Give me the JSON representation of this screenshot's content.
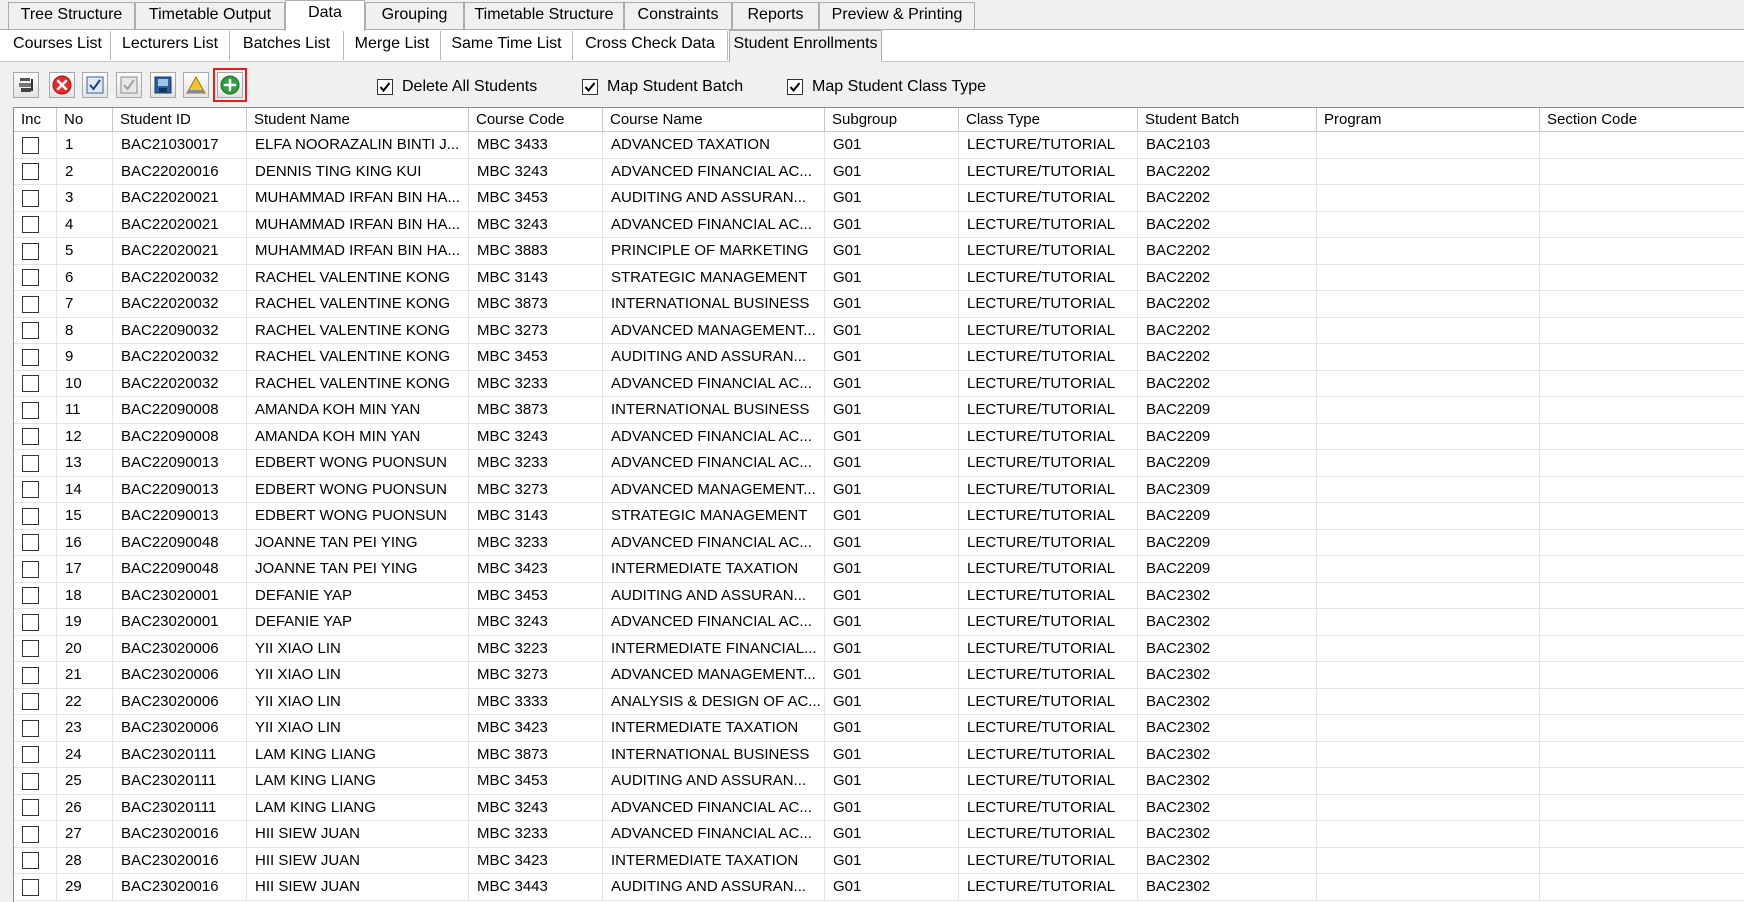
{
  "main_tabs": [
    {
      "label": "Tree Structure"
    },
    {
      "label": "Timetable Output"
    },
    {
      "label": "Data",
      "active": true
    },
    {
      "label": "Grouping"
    },
    {
      "label": "Timetable Structure"
    },
    {
      "label": "Constraints"
    },
    {
      "label": "Reports"
    },
    {
      "label": "Preview & Printing"
    }
  ],
  "sub_tabs": [
    {
      "label": "Courses List"
    },
    {
      "label": "Lecturers List"
    },
    {
      "label": "Batches List"
    },
    {
      "label": "Merge List"
    },
    {
      "label": "Same Time List"
    },
    {
      "label": "Cross Check Data"
    },
    {
      "label": "Student Enrollments",
      "active": true
    }
  ],
  "toolbar": {
    "buttons": [
      "import-icon",
      "delete-icon",
      "check-all-icon",
      "uncheck-all-icon",
      "save-icon",
      "warning-icon",
      "add-icon"
    ],
    "options": [
      {
        "label": "Delete All Students",
        "checked": true
      },
      {
        "label": "Map Student Batch",
        "checked": true
      },
      {
        "label": "Map Student Class Type",
        "checked": true
      }
    ]
  },
  "grid": {
    "columns": [
      "Inc",
      "No",
      "Student ID",
      "Student Name",
      "Course Code",
      "Course Name",
      "Subgroup",
      "Class Type",
      "Student Batch",
      "Program",
      "Section Code"
    ],
    "rows": [
      [
        "1",
        "BAC21030017",
        "ELFA NOORAZALIN BINTI J...",
        "MBC 3433",
        "ADVANCED TAXATION",
        "G01",
        "LECTURE/TUTORIAL",
        "BAC2103",
        "",
        ""
      ],
      [
        "2",
        "BAC22020016",
        "DENNIS TING KING KUI",
        "MBC 3243",
        "ADVANCED FINANCIAL AC...",
        "G01",
        "LECTURE/TUTORIAL",
        "BAC2202",
        "",
        ""
      ],
      [
        "3",
        "BAC22020021",
        "MUHAMMAD IRFAN BIN HA...",
        "MBC 3453",
        "AUDITING AND ASSURAN...",
        "G01",
        "LECTURE/TUTORIAL",
        "BAC2202",
        "",
        ""
      ],
      [
        "4",
        "BAC22020021",
        "MUHAMMAD IRFAN BIN HA...",
        "MBC 3243",
        "ADVANCED FINANCIAL AC...",
        "G01",
        "LECTURE/TUTORIAL",
        "BAC2202",
        "",
        ""
      ],
      [
        "5",
        "BAC22020021",
        "MUHAMMAD IRFAN BIN HA...",
        "MBC 3883",
        "PRINCIPLE OF MARKETING",
        "G01",
        "LECTURE/TUTORIAL",
        "BAC2202",
        "",
        ""
      ],
      [
        "6",
        "BAC22020032",
        "RACHEL VALENTINE KONG",
        "MBC 3143",
        "STRATEGIC MANAGEMENT",
        "G01",
        "LECTURE/TUTORIAL",
        "BAC2202",
        "",
        ""
      ],
      [
        "7",
        "BAC22020032",
        "RACHEL VALENTINE KONG",
        "MBC 3873",
        "INTERNATIONAL BUSINESS",
        "G01",
        "LECTURE/TUTORIAL",
        "BAC2202",
        "",
        ""
      ],
      [
        "8",
        "BAC22090032",
        "RACHEL VALENTINE KONG",
        "MBC 3273",
        "ADVANCED MANAGEMENT...",
        "G01",
        "LECTURE/TUTORIAL",
        "BAC2202",
        "",
        ""
      ],
      [
        "9",
        "BAC22020032",
        "RACHEL VALENTINE KONG",
        "MBC 3453",
        "AUDITING AND ASSURAN...",
        "G01",
        "LECTURE/TUTORIAL",
        "BAC2202",
        "",
        ""
      ],
      [
        "10",
        "BAC22020032",
        "RACHEL VALENTINE KONG",
        "MBC 3233",
        "ADVANCED FINANCIAL AC...",
        "G01",
        "LECTURE/TUTORIAL",
        "BAC2202",
        "",
        ""
      ],
      [
        "11",
        "BAC22090008",
        "AMANDA KOH MIN YAN",
        "MBC 3873",
        "INTERNATIONAL BUSINESS",
        "G01",
        "LECTURE/TUTORIAL",
        "BAC2209",
        "",
        ""
      ],
      [
        "12",
        "BAC22090008",
        "AMANDA KOH MIN YAN",
        "MBC 3243",
        "ADVANCED FINANCIAL AC...",
        "G01",
        "LECTURE/TUTORIAL",
        "BAC2209",
        "",
        ""
      ],
      [
        "13",
        "BAC22090013",
        "EDBERT WONG PUONSUN",
        "MBC 3233",
        "ADVANCED FINANCIAL AC...",
        "G01",
        "LECTURE/TUTORIAL",
        "BAC2209",
        "",
        ""
      ],
      [
        "14",
        "BAC22090013",
        "EDBERT WONG PUONSUN",
        "MBC 3273",
        "ADVANCED MANAGEMENT...",
        "G01",
        "LECTURE/TUTORIAL",
        "BAC2309",
        "",
        ""
      ],
      [
        "15",
        "BAC22090013",
        "EDBERT WONG PUONSUN",
        "MBC 3143",
        "STRATEGIC MANAGEMENT",
        "G01",
        "LECTURE/TUTORIAL",
        "BAC2209",
        "",
        ""
      ],
      [
        "16",
        "BAC22090048",
        "JOANNE TAN PEI YING",
        "MBC 3233",
        "ADVANCED FINANCIAL AC...",
        "G01",
        "LECTURE/TUTORIAL",
        "BAC2209",
        "",
        ""
      ],
      [
        "17",
        "BAC22090048",
        "JOANNE TAN PEI YING",
        "MBC 3423",
        "INTERMEDIATE TAXATION",
        "G01",
        "LECTURE/TUTORIAL",
        "BAC2209",
        "",
        ""
      ],
      [
        "18",
        "BAC23020001",
        "DEFANIE YAP",
        "MBC 3453",
        "AUDITING AND ASSURAN...",
        "G01",
        "LECTURE/TUTORIAL",
        "BAC2302",
        "",
        ""
      ],
      [
        "19",
        "BAC23020001",
        "DEFANIE YAP",
        "MBC 3243",
        "ADVANCED FINANCIAL AC...",
        "G01",
        "LECTURE/TUTORIAL",
        "BAC2302",
        "",
        ""
      ],
      [
        "20",
        "BAC23020006",
        "YII XIAO LIN",
        "MBC 3223",
        "INTERMEDIATE FINANCIAL...",
        "G01",
        "LECTURE/TUTORIAL",
        "BAC2302",
        "",
        ""
      ],
      [
        "21",
        "BAC23020006",
        "YII XIAO LIN",
        "MBC 3273",
        "ADVANCED MANAGEMENT...",
        "G01",
        "LECTURE/TUTORIAL",
        "BAC2302",
        "",
        ""
      ],
      [
        "22",
        "BAC23020006",
        "YII XIAO LIN",
        "MBC 3333",
        "ANALYSIS & DESIGN OF AC...",
        "G01",
        "LECTURE/TUTORIAL",
        "BAC2302",
        "",
        ""
      ],
      [
        "23",
        "BAC23020006",
        "YII XIAO LIN",
        "MBC 3423",
        "INTERMEDIATE TAXATION",
        "G01",
        "LECTURE/TUTORIAL",
        "BAC2302",
        "",
        ""
      ],
      [
        "24",
        "BAC23020111",
        "LAM KING LIANG",
        "MBC 3873",
        "INTERNATIONAL BUSINESS",
        "G01",
        "LECTURE/TUTORIAL",
        "BAC2302",
        "",
        ""
      ],
      [
        "25",
        "BAC23020111",
        "LAM KING LIANG",
        "MBC 3453",
        "AUDITING AND ASSURAN...",
        "G01",
        "LECTURE/TUTORIAL",
        "BAC2302",
        "",
        ""
      ],
      [
        "26",
        "BAC23020111",
        "LAM KING LIANG",
        "MBC 3243",
        "ADVANCED FINANCIAL AC...",
        "G01",
        "LECTURE/TUTORIAL",
        "BAC2302",
        "",
        ""
      ],
      [
        "27",
        "BAC23020016",
        "HII SIEW JUAN",
        "MBC 3233",
        "ADVANCED FINANCIAL AC...",
        "G01",
        "LECTURE/TUTORIAL",
        "BAC2302",
        "",
        ""
      ],
      [
        "28",
        "BAC23020016",
        "HII SIEW JUAN",
        "MBC 3423",
        "INTERMEDIATE TAXATION",
        "G01",
        "LECTURE/TUTORIAL",
        "BAC2302",
        "",
        ""
      ],
      [
        "29",
        "BAC23020016",
        "HII SIEW JUAN",
        "MBC 3443",
        "AUDITING AND ASSURAN...",
        "G01",
        "LECTURE/TUTORIAL",
        "BAC2302",
        "",
        ""
      ]
    ]
  }
}
